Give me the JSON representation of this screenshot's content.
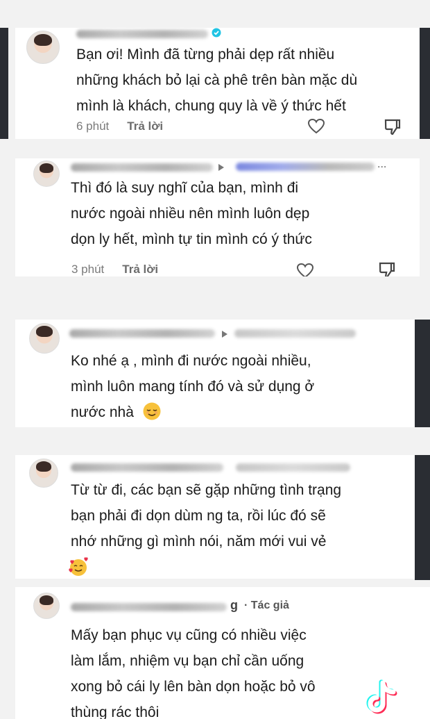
{
  "comments": [
    {
      "text_lines": [
        "Bạn ơi! Mình đã từng phải dẹp rất nhiều",
        "những khách bỏ lại cà phê trên bàn mặc dù",
        "mình là khách, chung quy là về ý thức hết"
      ],
      "time": "6 phút",
      "reply_label": "Trả lời"
    },
    {
      "text_lines": [
        "Thì đó là suy nghĩ của bạn, mình đi",
        "nước ngoài nhiều nên mình luôn dẹp",
        "dọn ly hết, mình tự tin mình có ý thức"
      ],
      "time": "3 phút",
      "reply_label": "Trả lời"
    },
    {
      "text_lines": [
        "Ko nhé ạ , mình đi nước ngoài nhiều,",
        "mình luôn mang tính đó và sử dụng ở",
        "nước nhà"
      ]
    },
    {
      "text_lines": [
        "Từ từ đi, các bạn sẽ gặp những tình trạng",
        "bạn phải đi dọn dùm ng ta, rồi lúc đó sẽ",
        "nhớ những gì mình nói, năm mới vui vẻ"
      ]
    },
    {
      "author_suffix": "g",
      "badge": "· Tác giả",
      "text_lines": [
        "Mấy bạn phục vụ cũng có nhiều việc",
        "làm lắm, nhiệm vụ bạn chỉ cần uống",
        "xong bỏ cái ly lên bàn dọn hoặc bỏ vô",
        "thùng rác thôi"
      ]
    }
  ],
  "icons": {
    "verified": "verified-badge-icon",
    "like": "heart-icon",
    "dislike": "dislike-icon",
    "reply_arrow": "reply-arrow-icon",
    "watermark": "tiktok-logo-icon",
    "emoji_relieved": "relieved-face-emoji",
    "emoji_hearts": "smiling-face-with-hearts-emoji"
  },
  "colors": {
    "verified": "#20c4e4",
    "heart_stroke": "#555555",
    "tiktok_red": "#fe2c55",
    "tiktok_cyan": "#25f4ee"
  }
}
